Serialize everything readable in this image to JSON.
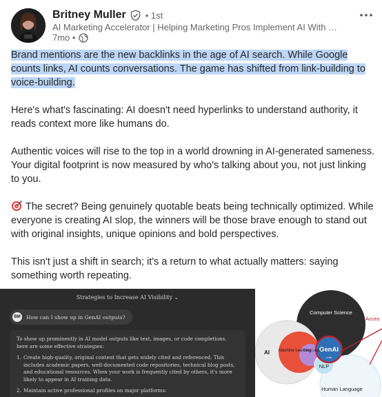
{
  "author": {
    "name": "Britney Muller",
    "degree": "• 1st",
    "headline": "AI Marketing Accelerator | Helping Marketing Pros Implement AI With Co...",
    "age": "7mo •",
    "avatar_text": "BM"
  },
  "post": {
    "paragraph_1": "Brand mentions are the new backlinks in the age of AI search. While Google counts links, AI counts conversations. The game has shifted from link-building to voice-building.",
    "paragraph_2": "Here's what's fascinating: AI doesn't need hyperlinks to understand authority, it reads context more like humans do.",
    "paragraph_3": "Authentic voices will rise to the top in a world drowning in AI-generated sameness. Your digital footprint is now measured by who's talking about you, not just linking to you.",
    "paragraph_4": "The secret? Being genuinely quotable beats being technically optimized. While everyone is creating AI slop, the winners will be those brave enough to stand out with original insights, unique opinions and bold perspectives.",
    "paragraph_5": "This isn't just a shift in search; it's a return to what actually matters: saying something worth repeating."
  },
  "image_left": {
    "title": "Strategies to Increase AI Visibility ⌄",
    "prompt_avatar": "BM",
    "prompt": "How can I show up in GenAI outputs?",
    "intro": "To show up prominently in AI model outputs like text, images, or code completions, here are some effective strategies:",
    "item_1_num": "1.",
    "item_1": "Create high-quality, original content that gets widely cited and referenced. This includes academic papers, well-documented code repositories, technical blog posts, and educational resources. When your work is frequently cited by others, it's more likely to appear in AI training data.",
    "item_2_num": "2.",
    "item_2": "Maintain active professional profiles on major platforms:"
  },
  "image_right": {
    "label_cs": "Computer Science",
    "label_access": "Acces",
    "label_ai": "AI",
    "label_ml": "Machine Learning",
    "label_deep": "Deep Learning",
    "label_genai": "GenAI",
    "label_llm": "LLMs",
    "label_nlp": "NLP",
    "label_human_language": "Human Language"
  },
  "colors": {
    "highlight": "#bcd6f7",
    "verified": "#666666",
    "genai_fill": "#2f6fb8",
    "genai_ring": "#c0202a",
    "ml_fill": "#e8503a",
    "deep_fill": "#b48ad8"
  },
  "icons": [
    "verified-shield-icon",
    "globe-icon",
    "more-options-icon",
    "target-emoji-icon"
  ]
}
